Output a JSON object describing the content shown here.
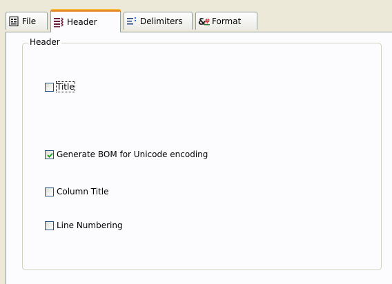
{
  "tabs": [
    {
      "label": "File",
      "icon": "file-properties-icon"
    },
    {
      "label": "Header",
      "icon": "header-lines-icon",
      "active": true
    },
    {
      "label": "Delimiters",
      "icon": "delimiters-icon"
    },
    {
      "label": "Format",
      "icon": "format-symbols-icon"
    }
  ],
  "group": {
    "legend": "Header"
  },
  "checkboxes": {
    "title": {
      "label": "Title",
      "checked": false
    },
    "bom": {
      "label": "Generate BOM for Unicode encoding",
      "checked": true
    },
    "column_title": {
      "label": "Column Title",
      "checked": false
    },
    "line_numbering": {
      "label": "Line Numbering",
      "checked": false
    }
  },
  "colors": {
    "active_tab_accent": "#e68b2c",
    "check_mark": "#21a121",
    "checkbox_border": "#1c5180"
  }
}
